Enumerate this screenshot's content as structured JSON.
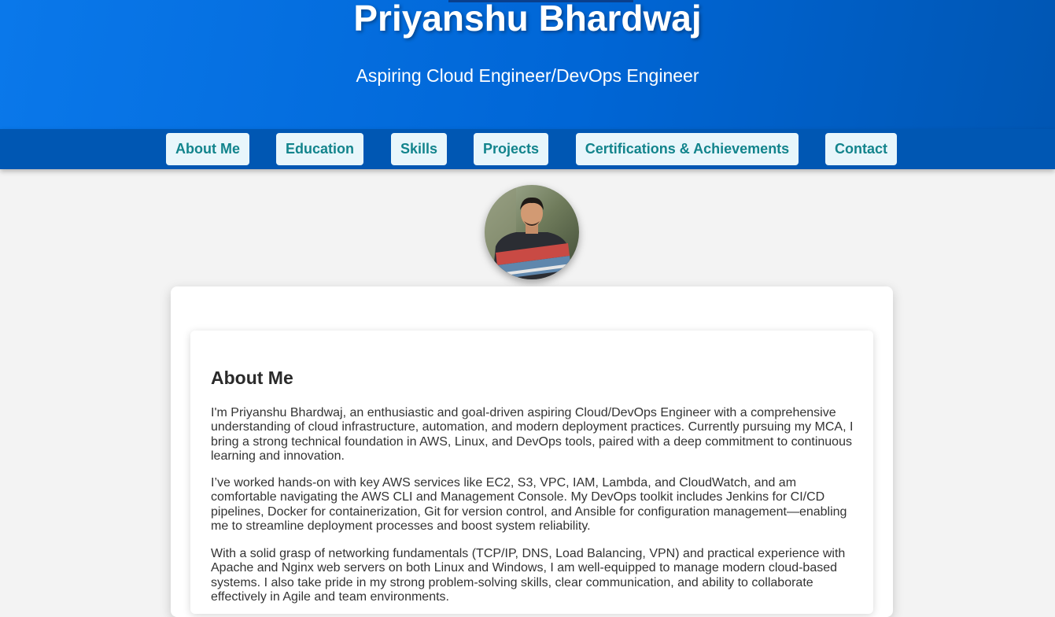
{
  "header": {
    "name": "Priyanshu Bhardwaj",
    "subtitle": "Aspiring Cloud Engineer/DevOps Engineer"
  },
  "nav": {
    "items": [
      {
        "label": "About Me"
      },
      {
        "label": "Education"
      },
      {
        "label": "Skills"
      },
      {
        "label": "Projects"
      },
      {
        "label": "Certifications & Achievements"
      },
      {
        "label": "Contact"
      }
    ]
  },
  "profile": {
    "photo_icon": "profile-photo"
  },
  "about": {
    "title": "About Me",
    "paragraphs": [
      "I'm Priyanshu Bhardwaj, an enthusiastic and goal-driven aspiring Cloud/DevOps Engineer with a comprehensive understanding of cloud infrastructure, automation, and modern deployment practices. Currently pursuing my MCA, I bring a strong technical foundation in AWS, Linux, and DevOps tools, paired with a deep commitment to continuous learning and innovation.",
      "I’ve worked hands-on with key AWS services like EC2, S3, VPC, IAM, Lambda, and CloudWatch, and am comfortable navigating the AWS CLI and Management Console. My DevOps toolkit includes Jenkins for CI/CD pipelines, Docker for containerization, Git for version control, and Ansible for configuration management—enabling me to streamline deployment processes and boost system reliability.",
      "With a solid grasp of networking fundamentals (TCP/IP, DNS, Load Balancing, VPN) and practical experience with Apache and Nginx web servers on both Linux and Windows, I am well-equipped to manage modern cloud-based systems. I also take pride in my strong problem-solving skills, clear communication, and ability to collaborate effectively in Agile and team environments."
    ]
  },
  "colors": {
    "header_gradient_start": "#0a78ea",
    "header_gradient_end": "#0056b3",
    "nav_bar": "#0057b3",
    "nav_button_bg": "#e8f6fb",
    "nav_button_text": "#12848c",
    "page_bg": "#f3f3f3"
  }
}
